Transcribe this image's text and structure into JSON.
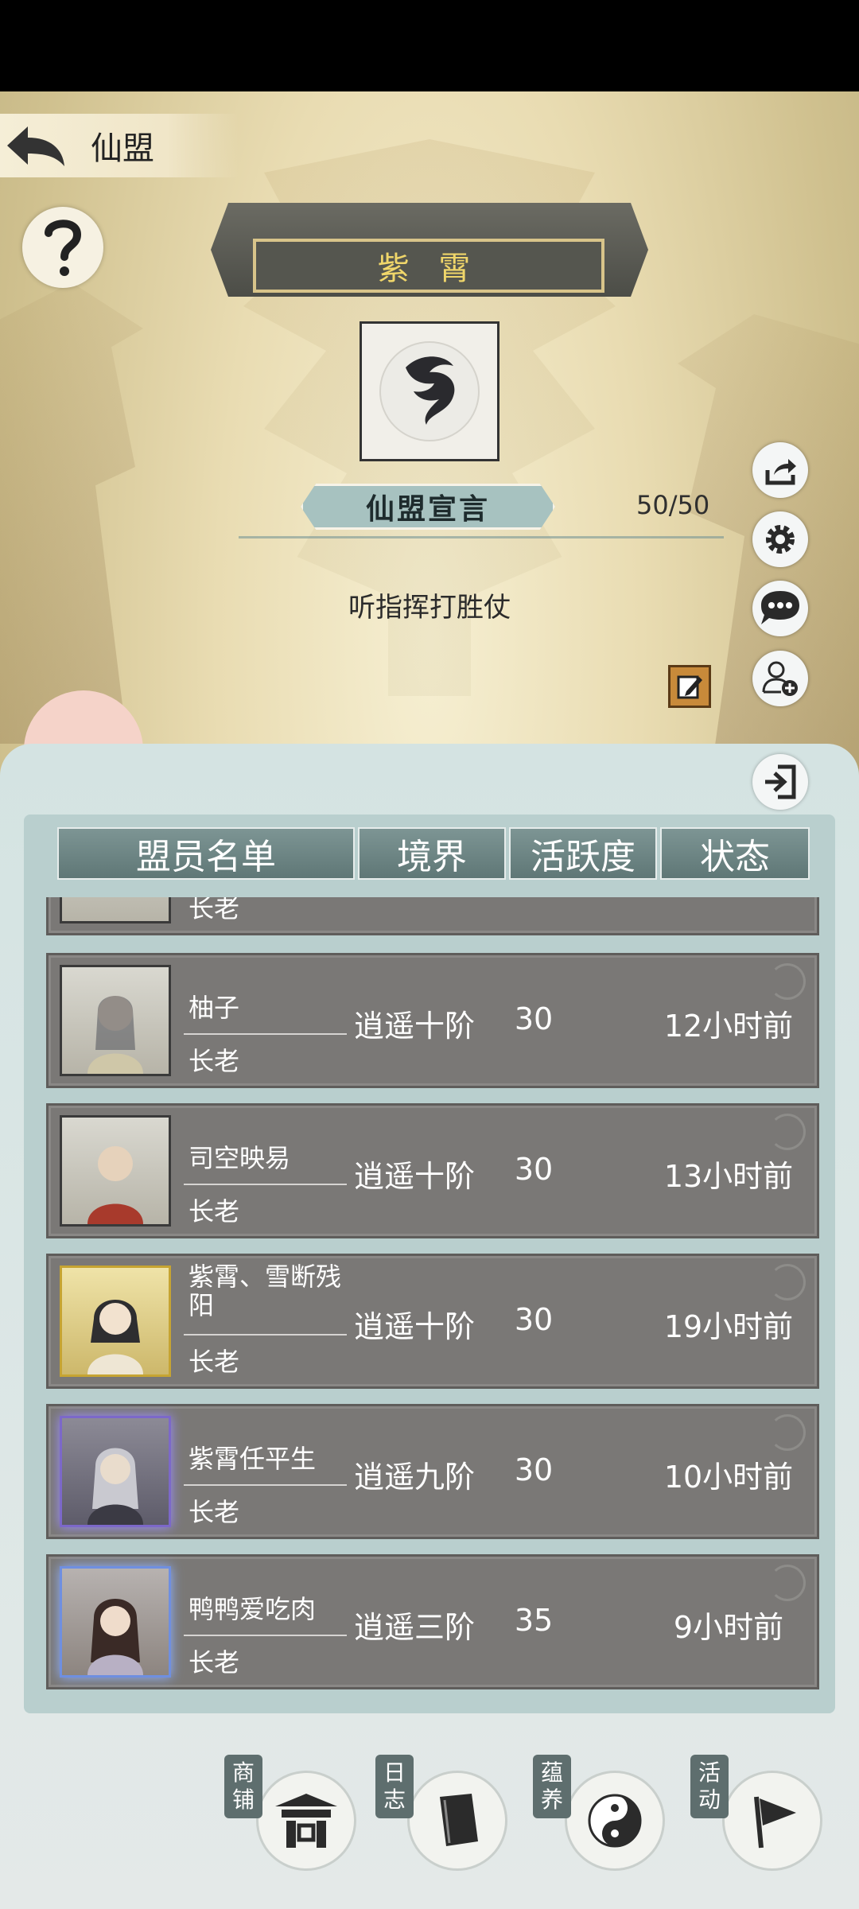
{
  "header": {
    "title": "仙盟"
  },
  "alliance": {
    "name": "紫 霄",
    "declaration_title": "仙盟宣言",
    "declaration_count": "50/50",
    "declaration_text": "听指挥打胜仗"
  },
  "member_list": {
    "columns": [
      "盟员名单",
      "境界",
      "活跃度",
      "状态"
    ],
    "partial_row_role": "长老",
    "rows": [
      {
        "name": "柚子",
        "role": "长老",
        "realm": "逍遥十阶",
        "activity": "30",
        "status": "12小时前",
        "frame": "plain"
      },
      {
        "name": "司空映易",
        "role": "长老",
        "realm": "逍遥十阶",
        "activity": "30",
        "status": "13小时前",
        "frame": "plain"
      },
      {
        "name": "紫霄、雪断残阳",
        "role": "长老",
        "realm": "逍遥十阶",
        "activity": "30",
        "status": "19小时前",
        "frame": "gold"
      },
      {
        "name": "紫霄任平生",
        "role": "长老",
        "realm": "逍遥九阶",
        "activity": "30",
        "status": "10小时前",
        "frame": "purple"
      },
      {
        "name": "鸭鸭爱吃肉",
        "role": "长老",
        "realm": "逍遥三阶",
        "activity": "35",
        "status": "9小时前",
        "frame": "blue"
      }
    ]
  },
  "bottom_nav": [
    {
      "label": "商铺",
      "icon": "shop-icon"
    },
    {
      "label": "日志",
      "icon": "log-book-icon"
    },
    {
      "label": "蕴养",
      "icon": "yin-yang-icon"
    },
    {
      "label": "活动",
      "icon": "flag-icon"
    }
  ],
  "colors": {
    "plaque_text": "#f0d66a",
    "row_bg": "#7a7876",
    "header_bg": "#6e8685"
  }
}
